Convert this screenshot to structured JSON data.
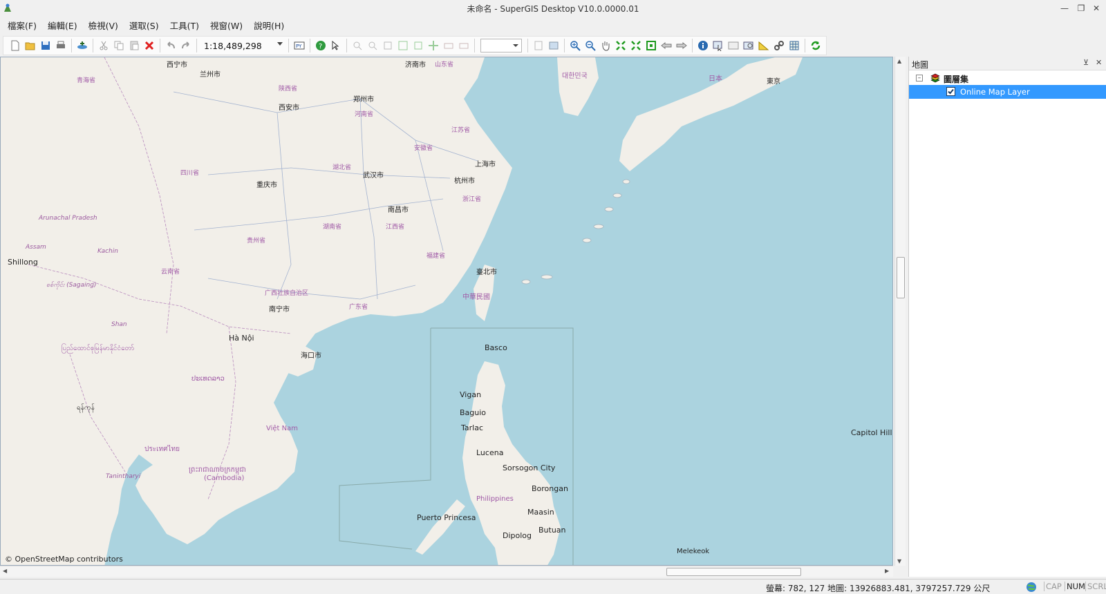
{
  "window": {
    "title": "未命名 - SuperGIS Desktop V10.0.0000.01",
    "controls": [
      "minimize-icon",
      "restore-icon",
      "close-icon"
    ]
  },
  "menu": [
    {
      "id": "file",
      "label": "檔案(F)"
    },
    {
      "id": "edit",
      "label": "編輯(E)"
    },
    {
      "id": "view",
      "label": "檢視(V)"
    },
    {
      "id": "select",
      "label": "選取(S)"
    },
    {
      "id": "tools",
      "label": "工具(T)"
    },
    {
      "id": "window",
      "label": "視窗(W)"
    },
    {
      "id": "help",
      "label": "說明(H)"
    }
  ],
  "toolbar": {
    "scale": "1:18,489,298",
    "layer_combo_value": ""
  },
  "map": {
    "attribution": "© OpenStreetMap contributors",
    "labels": {
      "xining": "西宁市",
      "lanzhou": "兰州市",
      "jinan": "济南市",
      "shandong": "山东省",
      "qinghai": "青海省",
      "shaanxi": "陕西省",
      "zhengzhou": "郑州市",
      "xian": "西安市",
      "henan": "河南省",
      "jiangsu": "江苏省",
      "anhui": "安徽省",
      "shanghai": "上海市",
      "hubei": "湖北省",
      "sichuan": "四川省",
      "wuhan": "武汉市",
      "chongqing": "重庆市",
      "hangzhou": "杭州市",
      "zhejiang": "浙江省",
      "nanchang": "南昌市",
      "arunachal": "Arunachal Pradesh",
      "hunan": "湖南省",
      "jiangxi": "江西省",
      "guizhou": "贵州省",
      "assam": "Assam",
      "kachin": "Kachin",
      "shillong": "Shillong",
      "fujian": "福建省",
      "taipei": "臺北市",
      "yunnan": "云南省",
      "sagaing": "စစ်ကိုင်း (Sagaing)",
      "guangxi": "广西壮族自治区",
      "roc": "中華民國",
      "guangdong": "广东省",
      "nanning": "南宁市",
      "shan": "Shan",
      "hanoi": "Hà Nội",
      "myanmar": "ပြည်ထောင်စုမြန်မာနိုင်ငံတော်",
      "haikou": "海口市",
      "basco": "Basco",
      "laos": "ປະເທດລາວ",
      "vigan": "Vigan",
      "baguio": "Baguio",
      "yangon": "ရန်ကုန်",
      "tarlac": "Tarlac",
      "vietnam": "Việt Nam",
      "capitol_hill": "Capitol Hill",
      "thailand": "ประเทศไทย",
      "lucena": "Lucena",
      "sorsogon": "Sorsogon City",
      "cambodia": "ព្រះរាជាណាចក្រកម្ពុជា",
      "cambodia_en": "(Cambodia)",
      "tanintharyi": "Tanintharyi",
      "borongan": "Borongan",
      "philippines": "Philippines",
      "maasin": "Maasin",
      "puerto_princesa": "Puerto Princesa",
      "butuan": "Butuan",
      "dipolog": "Dipolog",
      "melekeok": "Melekeok",
      "japan": "日本",
      "tokyo": "東京",
      "korea": "대한민국"
    }
  },
  "panel": {
    "title": "地圖",
    "group": "圖層集",
    "layer": "Online Map Layer",
    "layer_checked": true
  },
  "status": {
    "coords": "螢幕: 782, 127   地圖: 13926883.481, 3797257.729 公尺",
    "cap": "CAP",
    "num": "NUM",
    "scrl": "SCRL"
  },
  "colors": {
    "sea": "#abd3df",
    "land": "#f2efe9",
    "selection": "#3399ff",
    "boundary": "#a05aa6"
  }
}
